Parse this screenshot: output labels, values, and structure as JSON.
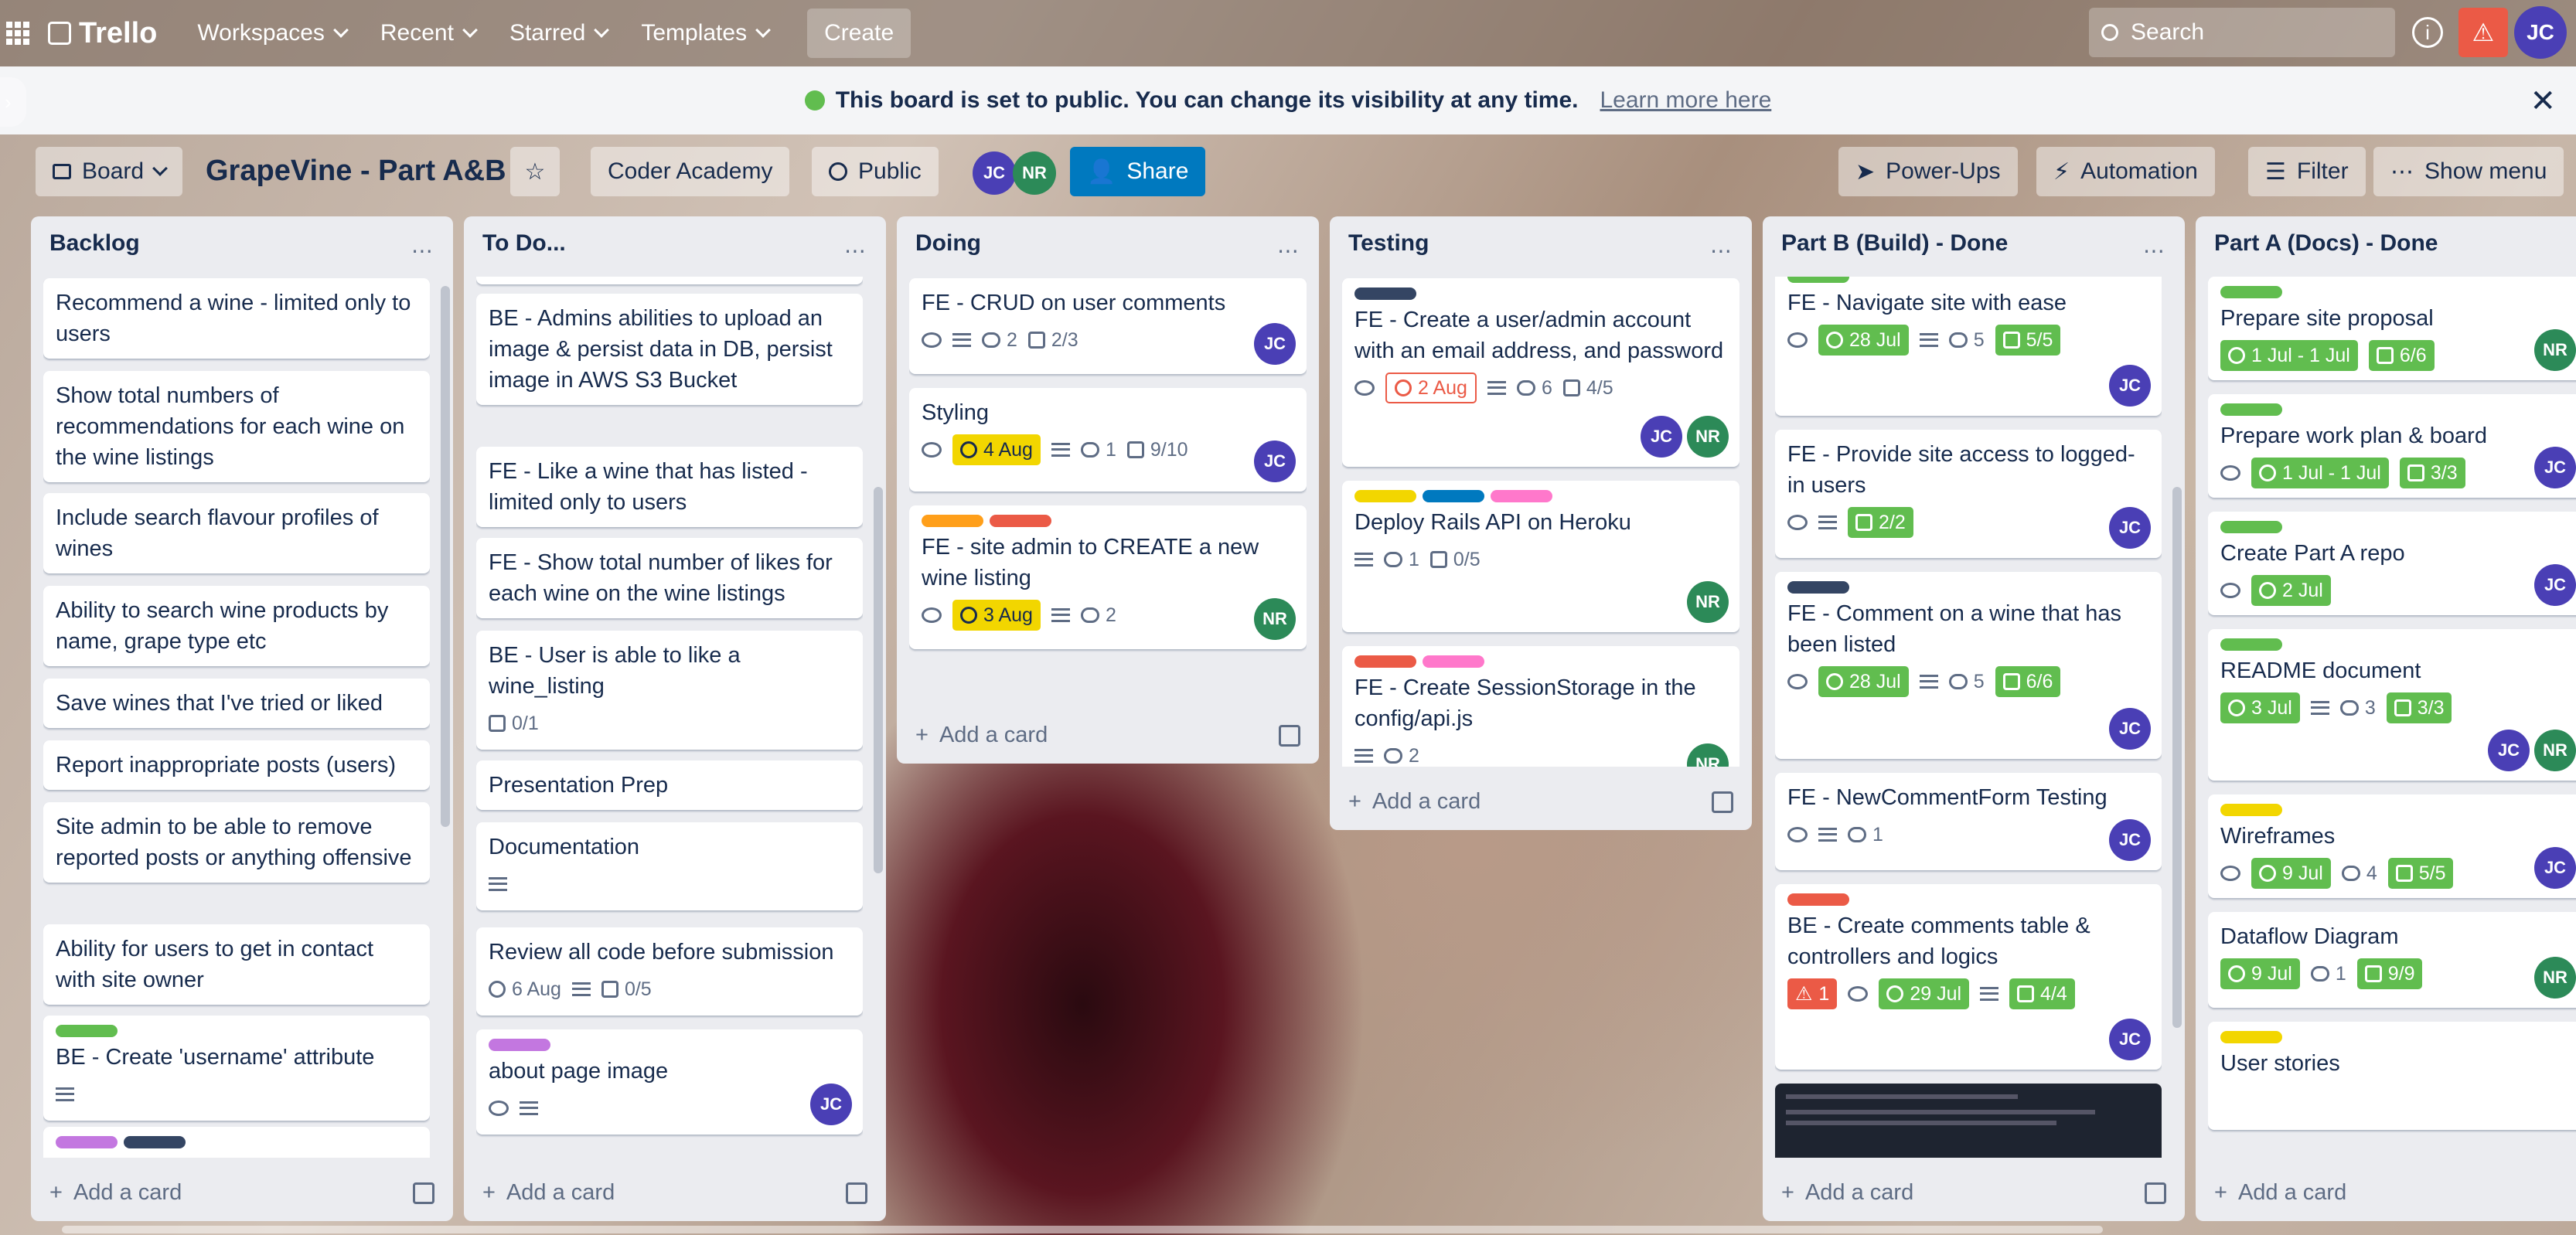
{
  "nav": {
    "brand": "Trello",
    "workspaces": "Workspaces",
    "recent": "Recent",
    "starred": "Starred",
    "templates": "Templates",
    "create": "Create",
    "search": "Search",
    "user": "JC"
  },
  "banner": {
    "text": "This board is set to public. You can change its visibility at any time.",
    "link": "Learn more here"
  },
  "board": {
    "view": "Board",
    "title": "GrapeVine - Part A&B",
    "workspace": "Coder Academy",
    "visibility": "Public",
    "members": [
      "JC",
      "NR"
    ],
    "share": "Share",
    "powerups": "Power-Ups",
    "automation": "Automation",
    "filter": "Filter",
    "show_menu": "Show menu"
  },
  "add_card": "Add a card",
  "lists": [
    {
      "title": "Backlog",
      "cards": [
        {
          "title": "Recommend a wine - limited only to users"
        },
        {
          "title": "Show total numbers of recommendations for each wine on the wine listings"
        },
        {
          "title": "Include search flavour profiles of wines"
        },
        {
          "title": "Ability to search wine products by name, grape type etc"
        },
        {
          "title": "Save wines that I've tried or liked"
        },
        {
          "title": "Report inappropriate posts (users)"
        },
        {
          "title": "Site admin to be able to remove reported posts or anything offensive"
        },
        {
          "title": "Ability for users to get in contact with site owner"
        },
        {
          "title": "BE - Create 'username' attribute"
        }
      ]
    },
    {
      "title": "To Do...",
      "cards": [
        {
          "title": "BE - Admins abilities to upload an image & persist data in DB, persist image in AWS S3 Bucket"
        },
        {
          "title": "FE - Like a wine that has listed - limited only to users"
        },
        {
          "title": "FE - Show total number of likes for each wine on the wine listings"
        },
        {
          "title": "BE - User is able to like a wine_listing",
          "check": "0/1"
        },
        {
          "title": "Presentation Prep"
        },
        {
          "title": "Documentation"
        },
        {
          "title": "Review all code before submission",
          "due": "6 Aug",
          "check": "0/5"
        },
        {
          "title": "about page image"
        }
      ]
    },
    {
      "title": "Doing",
      "cards": [
        {
          "title": "FE - CRUD on user comments",
          "comments": "2",
          "check": "2/3"
        },
        {
          "title": "Styling",
          "due": "4 Aug",
          "comments": "1",
          "check": "9/10"
        },
        {
          "title": "FE - site admin to CREATE a new wine listing",
          "due": "3 Aug",
          "comments": "2"
        }
      ]
    },
    {
      "title": "Testing",
      "cards": [
        {
          "title": "FE - Create a user/admin account with an email address, and password",
          "due": "2 Aug",
          "comments": "6",
          "check": "4/5"
        },
        {
          "title": "Deploy Rails API on Heroku",
          "comments": "1",
          "check": "0/5"
        },
        {
          "title": "FE - Create SessionStorage in the config/api.js",
          "comments": "2"
        }
      ]
    },
    {
      "title": "Part B (Build) - Done",
      "cards": [
        {
          "title": "FE - Navigate site with ease",
          "due": "28 Jul",
          "comments": "5",
          "check": "5/5"
        },
        {
          "title": "FE - Provide site access to logged-in users",
          "check": "2/2"
        },
        {
          "title": "FE - Comment on a wine that has been listed",
          "due": "28 Jul",
          "comments": "5",
          "check": "6/6"
        },
        {
          "title": "FE - NewCommentForm Testing",
          "comments": "1"
        },
        {
          "title": "BE - Create comments table & controllers and logics",
          "notif": "1",
          "due": "29 Jul",
          "check": "4/4"
        }
      ]
    },
    {
      "title": "Part A (Docs) - Done",
      "cards": [
        {
          "title": "Prepare site proposal",
          "due": "1 Jul - 1 Jul",
          "check": "6/6"
        },
        {
          "title": "Prepare work plan & board",
          "due": "1 Jul - 1 Jul",
          "check": "3/3"
        },
        {
          "title": "Create Part A repo",
          "due": "2 Jul"
        },
        {
          "title": "README document",
          "due": "3 Jul",
          "comments": "3",
          "check": "3/3"
        },
        {
          "title": "Wireframes",
          "due": "9 Jul",
          "comments": "4",
          "check": "5/5"
        },
        {
          "title": "Dataflow Diagram",
          "due": "9 Jul",
          "comments": "1",
          "check": "9/9"
        },
        {
          "title": "User stories"
        }
      ]
    }
  ],
  "colors": {
    "green": "#61bd4f",
    "red": "#eb5a46",
    "yellow": "#f2d600",
    "orange": "#ff9f1a",
    "purple": "#c377e0",
    "navy": "#344563",
    "blue": "#0079bf",
    "pink": "#ff78cb",
    "share": "#0079bf"
  }
}
